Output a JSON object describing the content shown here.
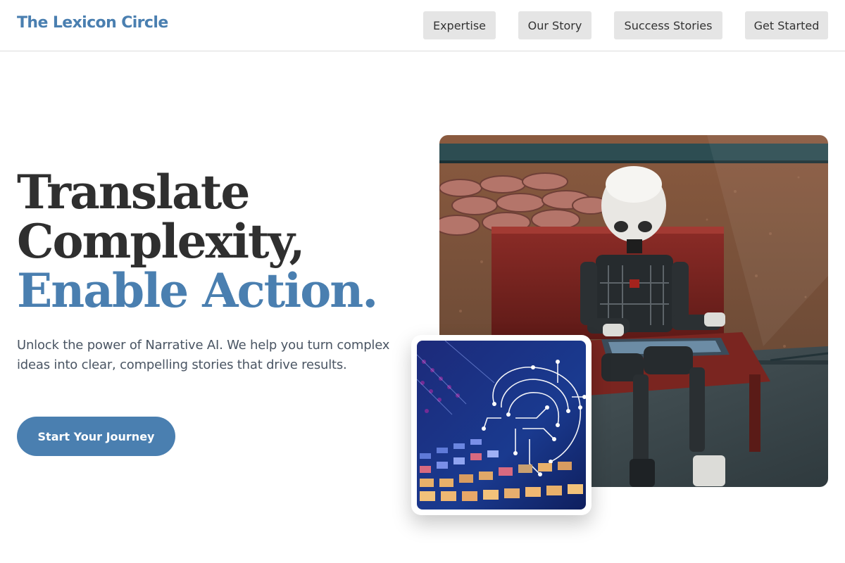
{
  "header": {
    "brand": "The Lexicon Circle",
    "nav": [
      {
        "label": "Expertise"
      },
      {
        "label": "Our Story"
      },
      {
        "label": "Success Stories"
      },
      {
        "label": "Get Started"
      }
    ]
  },
  "hero": {
    "headline_line1": "Translate",
    "headline_line2": "Complexity,",
    "headline_accent": "Enable Action.",
    "subtitle": "Unlock the power of Narrative AI. We help you turn complex ideas into clear, compelling stories that drive results.",
    "cta_label": "Start Your Journey"
  },
  "images": {
    "main_alt": "Robot reading a tablet on a bench",
    "inset_alt": "Circuit brain illustration"
  },
  "colors": {
    "accent": "#4a7fb0",
    "nav_bg": "#e5e5e5",
    "text_dark": "#2f2f2f"
  }
}
